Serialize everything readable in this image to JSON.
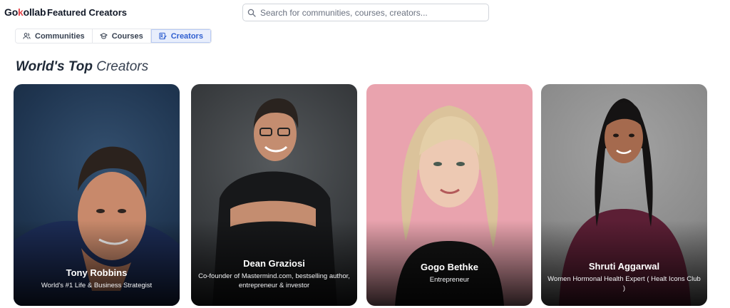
{
  "header": {
    "logo_text_a": "Go",
    "logo_text_k": "k",
    "logo_text_b": "ollab",
    "title": "Featured Creators"
  },
  "search": {
    "placeholder": "Search for communities, courses, creators..."
  },
  "tabs": [
    {
      "label": "Communities",
      "icon": "users-icon",
      "active": false
    },
    {
      "label": "Courses",
      "icon": "graduation-cap-icon",
      "active": false
    },
    {
      "label": "Creators",
      "icon": "creator-edit-icon",
      "active": true
    }
  ],
  "section": {
    "title_bold": "World's Top",
    "title_rest": "Creators"
  },
  "creators": [
    {
      "name": "Tony Robbins",
      "role": "World's #1 Life & Business Strategist",
      "bg": "#1f3550"
    },
    {
      "name": "Dean Graziosi",
      "role": "Co-founder of Mastermind.com, bestselling author, entrepreneur & investor",
      "bg": "#3a3d40"
    },
    {
      "name": "Gogo Bethke",
      "role": "Entrepreneur",
      "bg": "#e9a3ae"
    },
    {
      "name": "Shruti Aggarwal",
      "role": "Women Hormonal Health Expert ( Healt Icons Club )",
      "bg": "#8c8c8c"
    }
  ],
  "colors": {
    "accent": "#2f5fd0",
    "logo_accent": "#e5484d"
  }
}
